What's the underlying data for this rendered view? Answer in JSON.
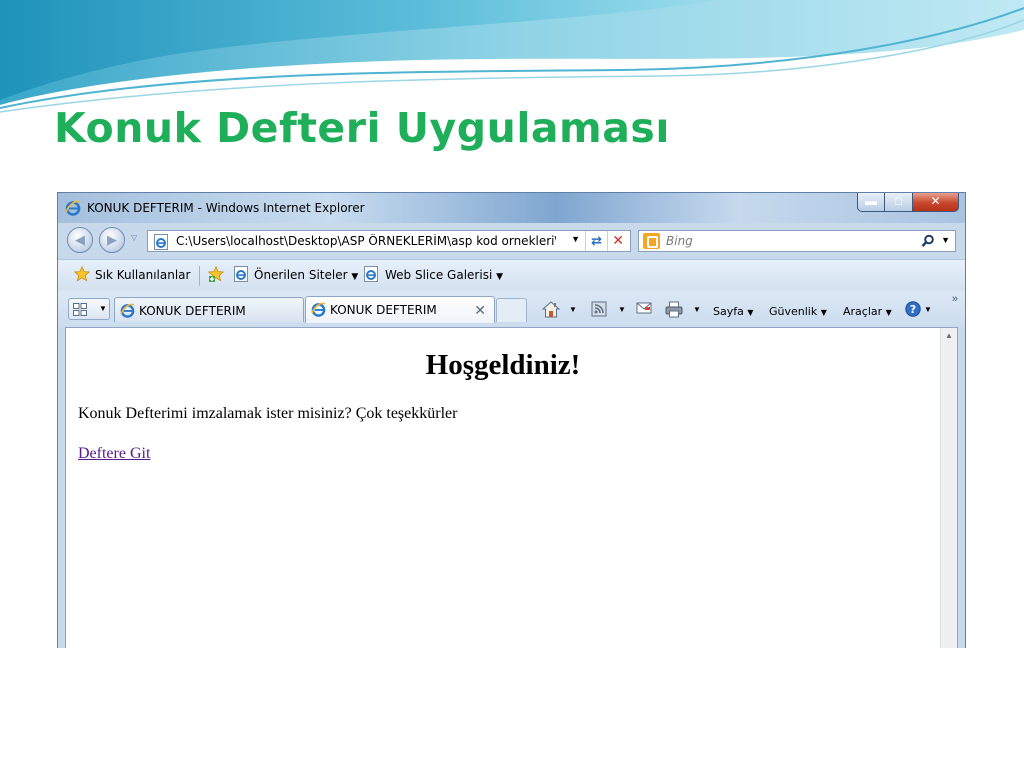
{
  "slide": {
    "title": "Konuk Defteri Uygulaması"
  },
  "window": {
    "title": "KONUK DEFTERIM - Windows Internet Explorer",
    "minimize_icon": "minimize-icon",
    "maximize_icon": "maximize-icon",
    "close_icon": "close-icon"
  },
  "address_bar": {
    "url": "C:\\Users\\localhost\\Desktop\\ASP ÖRNEKLERİM\\asp kod ornekleri\\ko",
    "search_placeholder": "Bing"
  },
  "favorites_bar": {
    "favorites_label": "Sık Kullanılanlar",
    "suggested_sites_label": "Önerilen Siteler",
    "web_slice_label": "Web Slice Galerisi"
  },
  "tabs": [
    {
      "label": "KONUK DEFTERIM",
      "active": false
    },
    {
      "label": "KONUK DEFTERIM",
      "active": true
    }
  ],
  "command_bar": {
    "page_label": "Sayfa",
    "safety_label": "Güvenlik",
    "tools_label": "Araçlar"
  },
  "page": {
    "heading": "Hoşgeldiniz!",
    "intro": "Konuk Defterimi imzalamak ister misiniz? Çok teşekkürler",
    "link": "Deftere Git"
  },
  "colors": {
    "title_green": "#1fae5a",
    "visited_link": "#551a8b",
    "close_button": "#c8472c"
  }
}
